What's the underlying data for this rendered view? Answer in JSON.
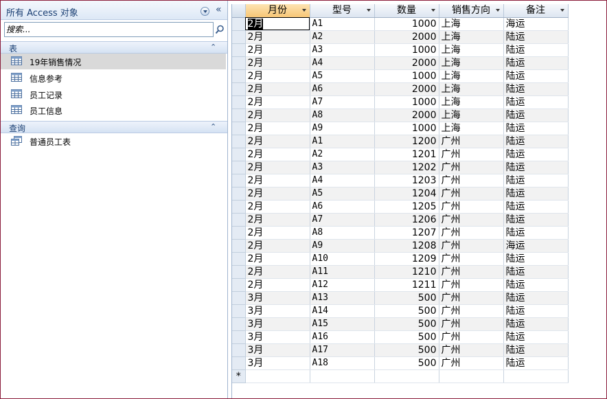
{
  "nav": {
    "title": "所有 Access 对象",
    "collapse_symbol": "«",
    "search_placeholder": "搜索...",
    "groups": [
      {
        "label": "表",
        "chevron": "⌃",
        "items": [
          "19年销售情况",
          "信息参考",
          "员工记录",
          "员工信息"
        ]
      },
      {
        "label": "查询",
        "chevron": "⌃",
        "items": [
          "普通员工表"
        ]
      }
    ],
    "selected_item": "19年销售情况"
  },
  "table": {
    "columns": [
      "月份",
      "型号",
      "数量",
      "销售方向",
      "备注"
    ],
    "new_row_marker": "*",
    "rows": [
      [
        "2月",
        "A1",
        "1000",
        "上海",
        "海运"
      ],
      [
        "2月",
        "A2",
        "2000",
        "上海",
        "陆运"
      ],
      [
        "2月",
        "A3",
        "1000",
        "上海",
        "陆运"
      ],
      [
        "2月",
        "A4",
        "2000",
        "上海",
        "陆运"
      ],
      [
        "2月",
        "A5",
        "1000",
        "上海",
        "陆运"
      ],
      [
        "2月",
        "A6",
        "2000",
        "上海",
        "陆运"
      ],
      [
        "2月",
        "A7",
        "1000",
        "上海",
        "陆运"
      ],
      [
        "2月",
        "A8",
        "2000",
        "上海",
        "陆运"
      ],
      [
        "2月",
        "A9",
        "1000",
        "上海",
        "陆运"
      ],
      [
        "2月",
        "A1",
        "1200",
        "广州",
        "陆运"
      ],
      [
        "2月",
        "A2",
        "1201",
        "广州",
        "陆运"
      ],
      [
        "2月",
        "A3",
        "1202",
        "广州",
        "陆运"
      ],
      [
        "2月",
        "A4",
        "1203",
        "广州",
        "陆运"
      ],
      [
        "2月",
        "A5",
        "1204",
        "广州",
        "陆运"
      ],
      [
        "2月",
        "A6",
        "1205",
        "广州",
        "陆运"
      ],
      [
        "2月",
        "A7",
        "1206",
        "广州",
        "陆运"
      ],
      [
        "2月",
        "A8",
        "1207",
        "广州",
        "陆运"
      ],
      [
        "2月",
        "A9",
        "1208",
        "广州",
        "海运"
      ],
      [
        "2月",
        "A10",
        "1209",
        "广州",
        "陆运"
      ],
      [
        "2月",
        "A11",
        "1210",
        "广州",
        "陆运"
      ],
      [
        "2月",
        "A12",
        "1211",
        "广州",
        "陆运"
      ],
      [
        "3月",
        "A13",
        "500",
        "广州",
        "陆运"
      ],
      [
        "3月",
        "A14",
        "500",
        "广州",
        "陆运"
      ],
      [
        "3月",
        "A15",
        "500",
        "广州",
        "陆运"
      ],
      [
        "3月",
        "A16",
        "500",
        "广州",
        "陆运"
      ],
      [
        "3月",
        "A17",
        "500",
        "广州",
        "陆运"
      ],
      [
        "3月",
        "A18",
        "500",
        "广州",
        "陆运"
      ]
    ]
  },
  "colors": {
    "window_border": "#8a1c3a",
    "header_selected": "#f7c676",
    "pane_text": "#1a3f73"
  }
}
